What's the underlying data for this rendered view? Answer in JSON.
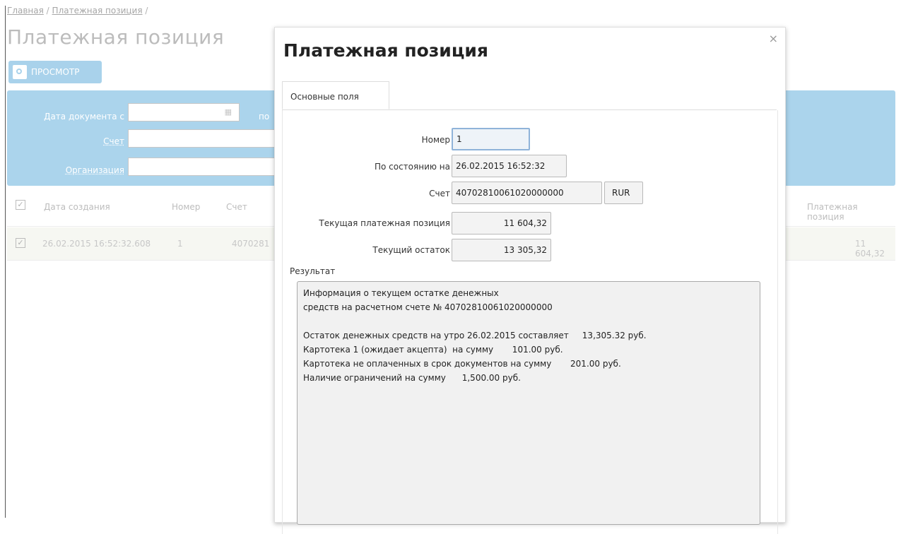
{
  "breadcrumb": {
    "home": "Главная",
    "current": "Платежная позиция",
    "sep": "/"
  },
  "page_title": "Платежная позиция",
  "toolbar": {
    "view_label": "ПРОСМОТР"
  },
  "filters": {
    "date_from_label": "Дата документа с",
    "date_to_label": "по",
    "account_label": "Счет",
    "organization_label": "Организация"
  },
  "grid": {
    "columns": [
      "Дата создания",
      "Номер",
      "Счет",
      "Платежная позиция"
    ],
    "rows": [
      {
        "created": "26.02.2015 16:52:32.608",
        "number": "1",
        "account": "4070281",
        "position": "11 604,32"
      }
    ]
  },
  "modal": {
    "title": "Платежная позиция",
    "close": "×",
    "tab": "Основные поля",
    "number_label": "Номер",
    "number_value": "1",
    "as_of_label": "По состоянию на",
    "as_of_value": "26.02.2015 16:52:32",
    "account_label": "Счет",
    "account_value": "40702810061020000000",
    "currency_value": "RUR",
    "current_position_label": "Текущая платежная позиция",
    "current_position_value": "11 604,32",
    "current_balance_label": "Текущий остаток",
    "current_balance_value": "13 305,32",
    "result_label": "Результат",
    "result_text": "Информация о текущем остатке денежных\nсредств на расчетном счете № 40702810061020000000\n\nОстаток денежных средств на утро 26.02.2015 составляет     13,305.32 руб.\nКартотека 1 (ожидает акцепта)  на сумму       101.00 руб.\nКартотека не оплаченных в срок документов на сумму       201.00 руб.\nНаличие ограничений на сумму      1,500.00 руб."
  }
}
